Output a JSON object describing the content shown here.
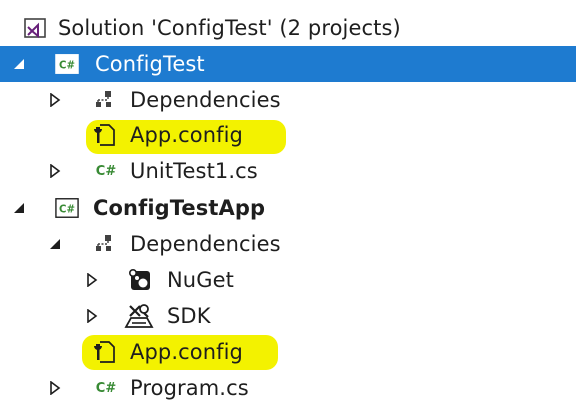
{
  "solution_explorer": {
    "solution_label": "Solution 'ConfigTest' (2 projects)",
    "project1": {
      "name": "ConfigTest",
      "badge": "C#",
      "items": {
        "dependencies": "Dependencies",
        "app_config": "App.config",
        "unittest": "UnitTest1.cs",
        "cs_glyph": "C#"
      }
    },
    "project2": {
      "name": "ConfigTestApp",
      "badge": "C#",
      "items": {
        "dependencies": "Dependencies",
        "nuget": "NuGet",
        "sdk": "SDK",
        "app_config": "App.config",
        "program": "Program.cs",
        "cs_glyph": "C#"
      }
    }
  },
  "colors": {
    "selection": "#1e7bd0",
    "highlight": "#f3f200",
    "csharp_green": "#388a34",
    "solution_purple": "#68217a"
  },
  "icons": {
    "solution": "visual-studio-solution-icon",
    "project": "csharp-project-icon",
    "dependencies": "dependencies-icon",
    "config": "config-file-icon",
    "csfile": "csharp-file-icon",
    "nuget": "nuget-icon",
    "sdk": "sdk-icon"
  }
}
